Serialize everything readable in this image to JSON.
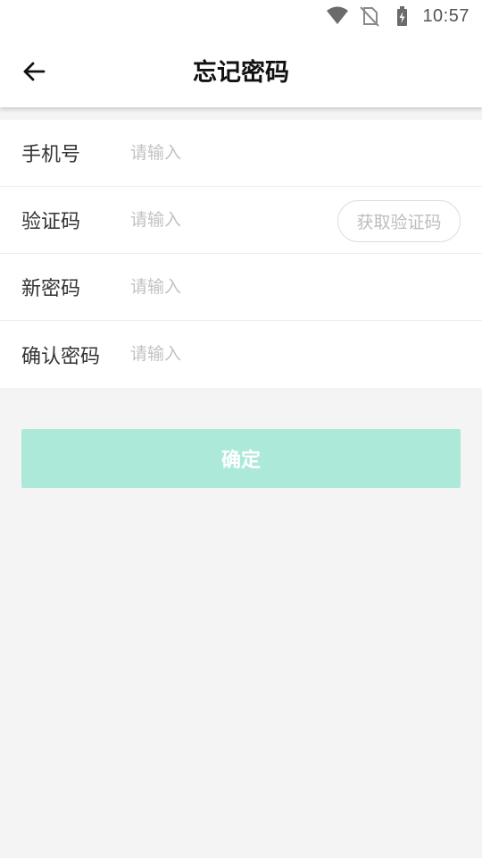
{
  "status_bar": {
    "time": "10:57",
    "icons": [
      "wifi-icon",
      "no-sim-icon",
      "battery-charging-icon"
    ]
  },
  "header": {
    "back_icon": "arrow-left-icon",
    "title": "忘记密码"
  },
  "form": {
    "phone": {
      "label": "手机号",
      "placeholder": "请输入",
      "value": ""
    },
    "code": {
      "label": "验证码",
      "placeholder": "请输入",
      "value": "",
      "button_label": "获取验证码"
    },
    "new_password": {
      "label": "新密码",
      "placeholder": "请输入",
      "value": ""
    },
    "confirm_password": {
      "label": "确认密码",
      "placeholder": "请输入",
      "value": ""
    }
  },
  "confirm_button": {
    "label": "确定"
  },
  "colors": {
    "accent_disabled": "#ade9d9",
    "page_background": "#f4f4f4",
    "placeholder": "#c2c2c2"
  }
}
